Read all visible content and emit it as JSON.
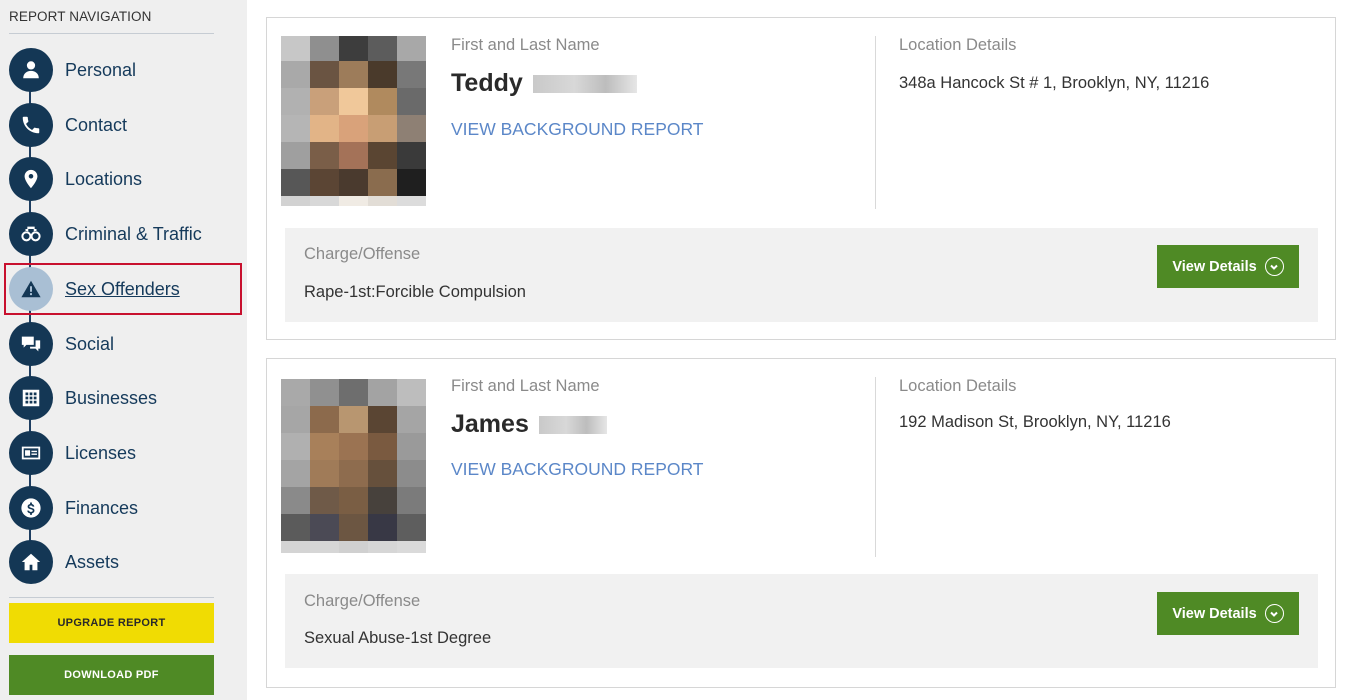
{
  "sidebar": {
    "heading": "REPORT NAVIGATION",
    "items": [
      {
        "label": "Personal",
        "icon": "person-icon"
      },
      {
        "label": "Contact",
        "icon": "phone-icon"
      },
      {
        "label": "Locations",
        "icon": "map-pin-icon"
      },
      {
        "label": "Criminal & Traffic",
        "icon": "handcuffs-icon"
      },
      {
        "label": "Sex Offenders",
        "icon": "warning-icon",
        "active": true
      },
      {
        "label": "Social",
        "icon": "chat-bubbles-icon"
      },
      {
        "label": "Businesses",
        "icon": "building-icon"
      },
      {
        "label": "Licenses",
        "icon": "id-card-icon"
      },
      {
        "label": "Finances",
        "icon": "dollar-icon"
      },
      {
        "label": "Assets",
        "icon": "home-icon"
      }
    ],
    "upgrade_label": "UPGRADE REPORT",
    "download_label": "DOWNLOAD PDF"
  },
  "colors": {
    "nav_circle": "#143755",
    "active_circle": "#a9bfd4",
    "active_highlight": "#c8102e",
    "link": "#5b87c8",
    "button_green": "#4f8a25",
    "button_yellow": "#f0dc03"
  },
  "records": [
    {
      "name_label": "First and Last Name",
      "name": "Teddy",
      "link_label": "VIEW BACKGROUND REPORT",
      "location_label": "Location Details",
      "location": "348a Hancock St # 1, Brooklyn, NY, 11216",
      "charge_label": "Charge/Offense",
      "charge": "Rape-1st:Forcible Compulsion",
      "details_label": "View Details"
    },
    {
      "name_label": "First and Last Name",
      "name": "James",
      "link_label": "VIEW BACKGROUND REPORT",
      "location_label": "Location Details",
      "location": "192 Madison St, Brooklyn, NY, 11216",
      "charge_label": "Charge/Offense",
      "charge": "Sexual Abuse-1st Degree",
      "details_label": "View Details"
    }
  ]
}
